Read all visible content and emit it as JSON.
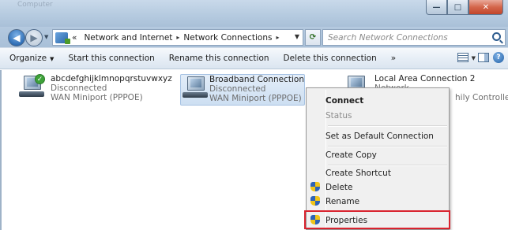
{
  "titlebar": {
    "faint_text": "Computer",
    "buttons": {
      "minimize": "—",
      "maximize": "□",
      "close": "✕"
    }
  },
  "nav": {
    "back_icon": "◀",
    "forward_icon": "▶",
    "history_caret": "▼",
    "address_prefix": "«",
    "breadcrumbs": [
      "Network and Internet",
      "Network Connections"
    ],
    "crumb_separator": "▸",
    "address_dropdown": "▼",
    "refresh_icon": "⟳",
    "search_placeholder": "Search Network Connections"
  },
  "commandbar": {
    "organize": "Organize",
    "caret": "▼",
    "start": "Start this connection",
    "rename": "Rename this connection",
    "delete": "Delete this connection",
    "more": "»",
    "help": "?"
  },
  "connections": [
    {
      "name": "abcdefghijklmnopqrstuvwxyz",
      "status": "Disconnected",
      "device": "WAN Miniport (PPPOE)",
      "icon": "network-adapter-icon",
      "badge": "✓"
    },
    {
      "name": "Broadband Connection",
      "status": "Disconnected",
      "device": "WAN Miniport (PPPOE)",
      "icon": "network-adapter-icon"
    },
    {
      "name": "Local Area Connection 2",
      "status": "Network",
      "device": "hily Controller",
      "icon": "network-adapter-icon"
    }
  ],
  "context_menu": {
    "items": [
      {
        "label": "Connect",
        "bold": true
      },
      {
        "label": "Status",
        "disabled": true
      },
      {
        "label": "Set as Default Connection"
      },
      {
        "label": "Create Copy"
      },
      {
        "label": "Create Shortcut"
      },
      {
        "label": "Delete",
        "icon": "uac-shield-icon"
      },
      {
        "label": "Rename",
        "icon": "uac-shield-icon"
      },
      {
        "label": "Properties",
        "icon": "uac-shield-icon"
      }
    ]
  },
  "colors": {
    "highlight_box": "#d9232e",
    "selection_bg": "#cddff2",
    "status_ok": "#3ea23a"
  }
}
